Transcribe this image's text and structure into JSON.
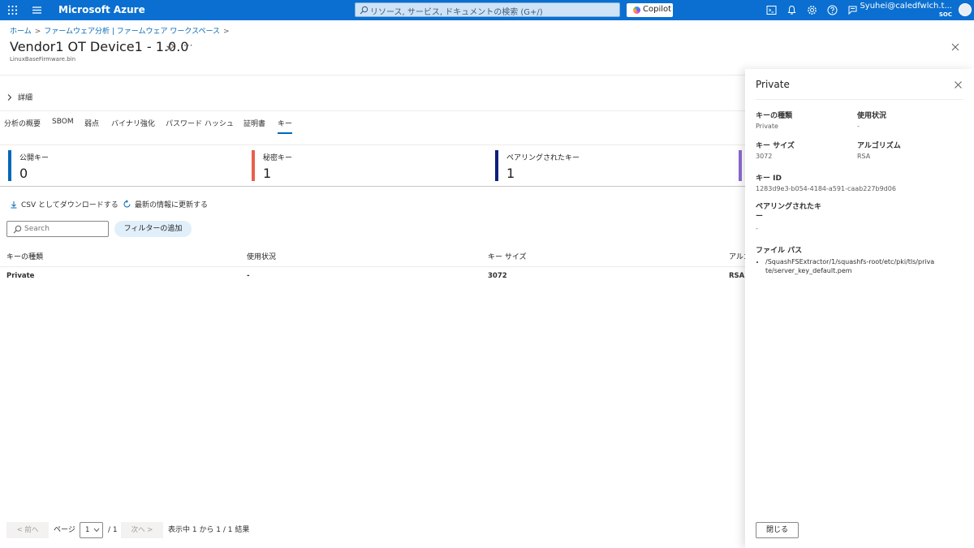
{
  "topbar": {
    "brand": "Microsoft Azure",
    "search_placeholder": "リソース, サービス, ドキュメントの検索 (G+/)",
    "copilot_label": "Copilot",
    "user_name": "Syuhei@caledfwlch.t...",
    "user_tenant": "SOC",
    "accent": "#0a6fd0"
  },
  "breadcrumb": [
    "ホーム",
    "ファームウェア分析 | ファームウェア ワークスペース"
  ],
  "header": {
    "title": "Vendor1 OT Device1 - 1.0.0",
    "more": "···",
    "subtitle": "LinuxBaseFirmware.bin"
  },
  "details_label": "詳細",
  "tabs": [
    {
      "label": "分析の概要",
      "active": false
    },
    {
      "label": "SBOM",
      "active": false
    },
    {
      "label": "弱点",
      "active": false
    },
    {
      "label": "バイナリ強化",
      "active": false
    },
    {
      "label": "パスワード ハッシュ",
      "active": false
    },
    {
      "label": "証明書",
      "active": false
    },
    {
      "label": "キー",
      "active": true
    }
  ],
  "summary_cards": [
    {
      "label": "公開キー",
      "value": "0",
      "color": "#0067b8"
    },
    {
      "label": "秘密キー",
      "value": "1",
      "color": "#e8604c"
    },
    {
      "label": "ペアリングされたキー",
      "value": "1",
      "color": "#0b1f7a"
    },
    {
      "label": "",
      "value": "",
      "color": "#8a6bd1"
    }
  ],
  "actions": {
    "download_csv": "CSV としてダウンロードする",
    "refresh": "最新の情報に更新する"
  },
  "filter": {
    "search_placeholder": "Search",
    "add_filter": "フィルターの追加"
  },
  "table": {
    "columns": [
      "キーの種類",
      "使用状況",
      "キー サイズ",
      "アルゴリズム"
    ],
    "rows": [
      [
        "Private",
        "-",
        "3072",
        "RSA"
      ]
    ]
  },
  "pagination": {
    "prev": "< 前へ",
    "page_label": "ページ",
    "current_page": "1",
    "total_pages": "/ 1",
    "next": "次へ >",
    "results": "表示中 1 から 1 / 1 結果"
  },
  "panel": {
    "title": "Private",
    "key_type_label": "キーの種類",
    "key_type_value": "Private",
    "usage_label": "使用状況",
    "usage_value": "-",
    "key_size_label": "キー サイズ",
    "key_size_value": "3072",
    "algorithm_label": "アルゴリズム",
    "algorithm_value": "RSA",
    "key_id_label": "キー ID",
    "key_id_value": "1283d9e3-b054-4184-a591-caab227b9d06",
    "paired_key_label": "ペアリングされたキー",
    "paired_key_value": "-",
    "file_path_label": "ファイル パス",
    "file_paths": [
      "/SquashFSExtractor/1/squashfs-root/etc/pki/tls/private/server_key_default.pem"
    ],
    "close_button": "閉じる"
  }
}
